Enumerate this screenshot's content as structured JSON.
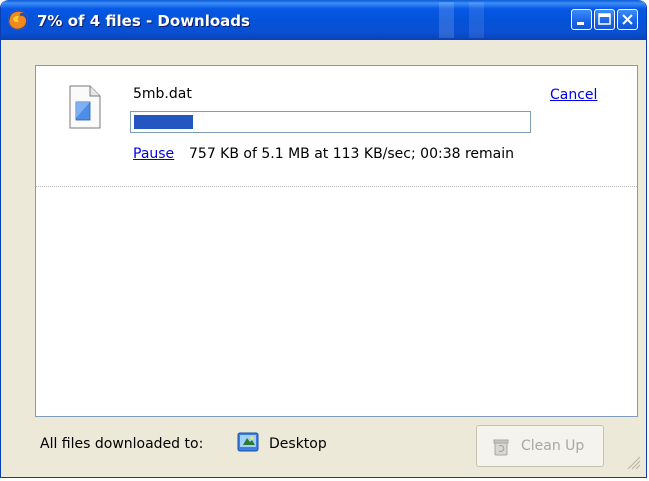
{
  "window": {
    "title": "7% of 4 files - Downloads",
    "app_icon": "firefox-icon"
  },
  "titlebar_buttons": [
    {
      "name": "minimize-button",
      "icon": "minimize-icon"
    },
    {
      "name": "maximize-button",
      "icon": "maximize-icon"
    },
    {
      "name": "close-button",
      "icon": "close-icon"
    }
  ],
  "download": {
    "file_name": "5mb.dat",
    "file_icon": "generic-file-icon",
    "cancel_label": "Cancel",
    "pause_label": "Pause",
    "status": "757 KB of 5.1 MB at 113 KB/sec; 00:38 remain",
    "progress_fraction": 0.15,
    "progress_color": "#2456c2"
  },
  "footer": {
    "label": "All files downloaded to:",
    "folder_name": "Desktop",
    "folder_icon": "desktop-folder-icon",
    "cleanup_label": "Clean Up",
    "cleanup_icon": "cleanup-icon",
    "cleanup_enabled": false
  },
  "colors": {
    "titlebar": "#0452d8",
    "window_face": "#ece9d8",
    "link": "#0000ee"
  }
}
